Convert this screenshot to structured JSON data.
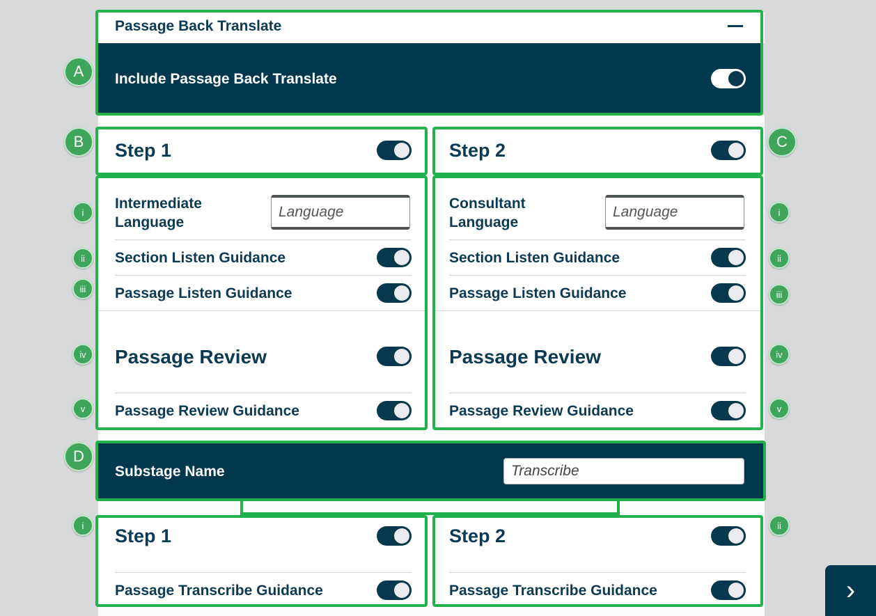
{
  "section": {
    "title": "Passage Back Translate",
    "collapse_icon": "minus-icon",
    "include_label": "Include Passage Back Translate",
    "include_on": true
  },
  "steps": [
    {
      "title": "Step 1",
      "on": true,
      "language_label_line1": "Intermediate",
      "language_label_line2": "Language",
      "language_placeholder": "Language",
      "section_listen_label": "Section Listen Guidance",
      "passage_listen_label": "Passage Listen Guidance",
      "passage_review_label": "Passage Review",
      "passage_review_guidance_label": "Passage Review Guidance"
    },
    {
      "title": "Step 2",
      "on": true,
      "language_label_line1": "Consultant",
      "language_label_line2": "Language",
      "language_placeholder": "Language",
      "section_listen_label": "Section Listen Guidance",
      "passage_listen_label": "Passage Listen Guidance",
      "passage_review_label": "Passage Review",
      "passage_review_guidance_label": "Passage Review Guidance"
    }
  ],
  "substage": {
    "label": "Substage Name",
    "placeholder": "Transcribe",
    "steps": [
      {
        "title": "Step 1",
        "guidance_label": "Passage Transcribe Guidance"
      },
      {
        "title": "Step 2",
        "guidance_label": "Passage Transcribe Guidance"
      }
    ]
  },
  "badges": {
    "a": "A",
    "b": "B",
    "c": "C",
    "d": "D",
    "i": "i",
    "ii": "ii",
    "iii": "iii",
    "iv": "iv",
    "v": "v"
  },
  "next_icon": "chevron-right-icon",
  "next_glyph": "›",
  "colors": {
    "navy": "#01384d",
    "frame_green": "#22b14c",
    "badge_green": "#3fa55c"
  }
}
